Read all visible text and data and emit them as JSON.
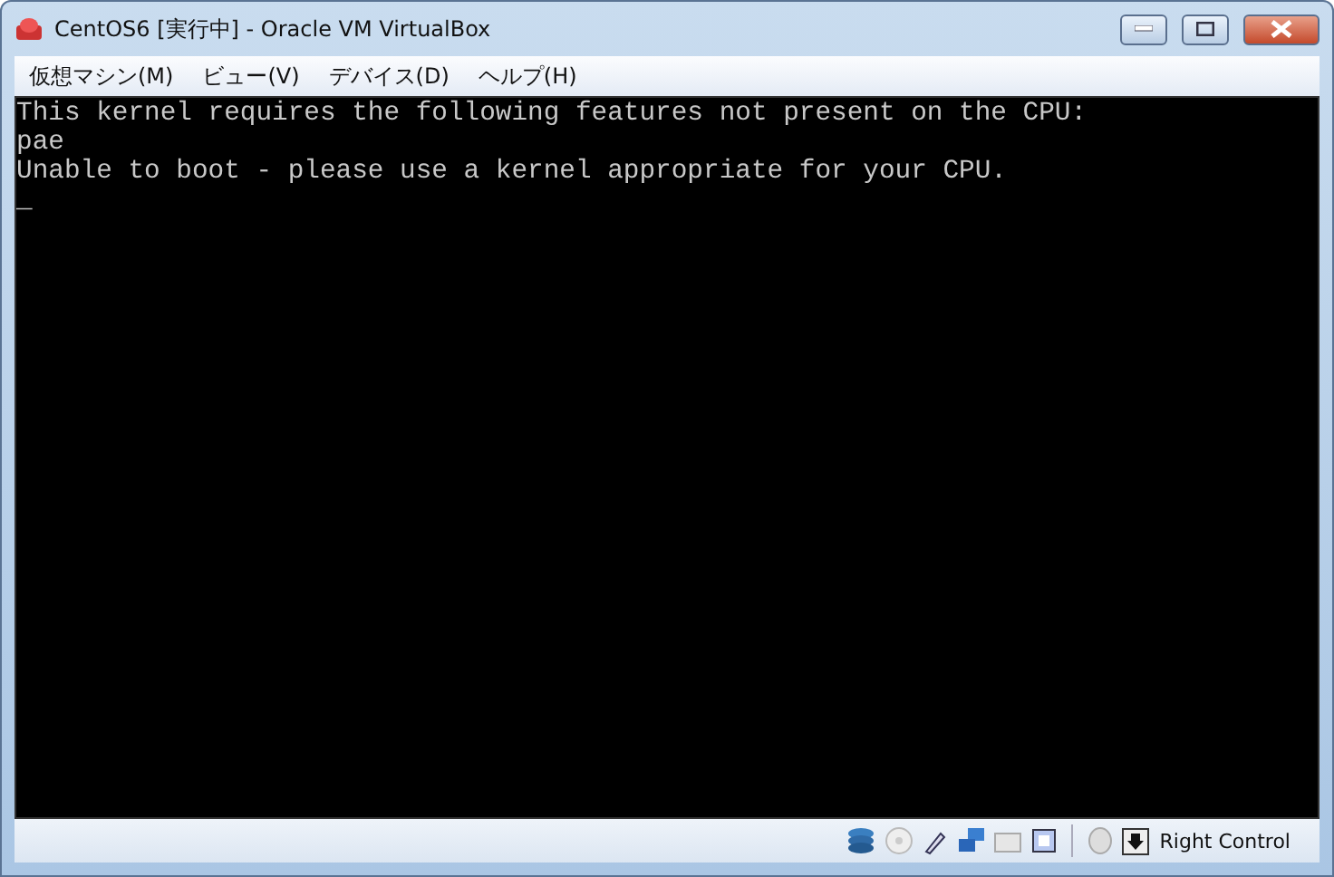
{
  "window": {
    "title": "CentOS6 [実行中] - Oracle VM VirtualBox"
  },
  "menu": [
    "仮想マシン(M)",
    "ビュー(V)",
    "デバイス(D)",
    "ヘルプ(H)"
  ],
  "console": {
    "lines": [
      "This kernel requires the following features not present on the CPU:",
      "pae",
      "Unable to boot - please use a kernel appropriate for your CPU."
    ],
    "cursor": "_"
  },
  "status_bar": {
    "host_key": "Right Control"
  }
}
